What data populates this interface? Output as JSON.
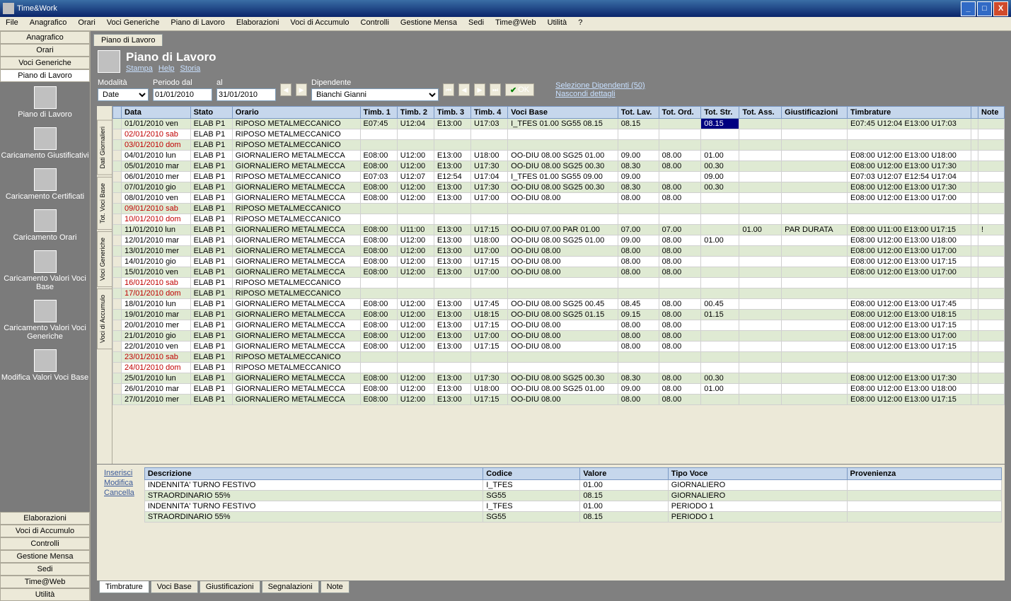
{
  "window": {
    "title": "Time&Work"
  },
  "menubar": [
    "File",
    "Anagrafico",
    "Orari",
    "Voci Generiche",
    "Piano di Lavoro",
    "Elaborazioni",
    "Voci di Accumulo",
    "Controlli",
    "Gestione Mensa",
    "Sedi",
    "Time@Web",
    "Utilità",
    "?"
  ],
  "sidebar_top": [
    "Anagrafico",
    "Orari",
    "Voci Generiche",
    "Piano di Lavoro"
  ],
  "sidebar_icons": [
    "Piano di Lavoro",
    "Caricamento Giustificativi",
    "Caricamento Certificati",
    "Caricamento Orari",
    "Caricamento Valori Voci Base",
    "Caricamento Valori Voci Generiche",
    "Modifica Valori Voci Base"
  ],
  "sidebar_bottom": [
    "Elaborazioni",
    "Voci di Accumulo",
    "Controlli",
    "Gestione Mensa",
    "Sedi",
    "Time@Web",
    "Utilità"
  ],
  "tab": "Piano di Lavoro",
  "page": {
    "title": "Piano di Lavoro",
    "links": [
      "Stampa",
      "Help",
      "Storia"
    ]
  },
  "filters": {
    "modalita_label": "Modalità",
    "modalita_value": "Date",
    "periodo_label": "Periodo dal",
    "dal": "01/01/2010",
    "al_label": "al",
    "al": "31/01/2010",
    "dipendente_label": "Dipendente",
    "dipendente": "Bianchi Gianni",
    "ok": "OK",
    "sel_link": "Selezione Dipendenti (50)",
    "hide_link": "Nascondi dettagli"
  },
  "side_tabs": [
    "Dati Giornalieri",
    "Tot. Voci Base",
    "Voci Generiche",
    "Voci di Accumulo"
  ],
  "grid": {
    "headers": [
      "",
      "Data",
      "Stato",
      "Orario",
      "Timb. 1",
      "Timb. 2",
      "Timb. 3",
      "Timb. 4",
      "Voci Base",
      "Tot. Lav.",
      "Tot. Ord.",
      "Tot. Str.",
      "Tot. Ass.",
      "Giustificazioni",
      "Timbrature",
      "",
      "Note"
    ],
    "rows": [
      {
        "alt": true,
        "d": "01/01/2010 ven",
        "s": "ELAB P1",
        "o": "RIPOSO METALMECCANICO",
        "t": [
          "E07:45",
          "U12:04",
          "E13:00",
          "U17:03"
        ],
        "vb": "I_TFES 01.00 SG55 08.15",
        "tl": "08.15",
        "to": "",
        "ts": "08.15",
        "ts_sel": true,
        "ta": "",
        "g": "",
        "tm": "E07:45 U12:04 E13:00 U17:03",
        "n": ""
      },
      {
        "d": "02/01/2010 sab",
        "red": true,
        "s": "ELAB P1",
        "o": "RIPOSO METALMECCANICO",
        "t": [
          "",
          "",
          "",
          ""
        ],
        "vb": "",
        "tl": "",
        "to": "",
        "ts": "",
        "ta": "",
        "g": "",
        "tm": "",
        "n": ""
      },
      {
        "alt": true,
        "d": "03/01/2010 dom",
        "red": true,
        "s": "ELAB P1",
        "o": "RIPOSO METALMECCANICO",
        "t": [
          "",
          "",
          "",
          ""
        ],
        "vb": "",
        "tl": "",
        "to": "",
        "ts": "",
        "ta": "",
        "g": "",
        "tm": "",
        "n": ""
      },
      {
        "d": "04/01/2010 lun",
        "s": "ELAB P1",
        "o": "GIORNALIERO METALMECCA",
        "t": [
          "E08:00",
          "U12:00",
          "E13:00",
          "U18:00"
        ],
        "vb": "OO-DIU 08.00 SG25 01.00",
        "tl": "09.00",
        "to": "08.00",
        "ts": "01.00",
        "ta": "",
        "g": "",
        "tm": "E08:00 U12:00 E13:00 U18:00",
        "n": ""
      },
      {
        "alt": true,
        "d": "05/01/2010 mar",
        "s": "ELAB P1",
        "o": "GIORNALIERO METALMECCA",
        "t": [
          "E08:00",
          "U12:00",
          "E13:00",
          "U17:30"
        ],
        "vb": "OO-DIU 08.00 SG25 00.30",
        "tl": "08.30",
        "to": "08.00",
        "ts": "00.30",
        "ta": "",
        "g": "",
        "tm": "E08:00 U12:00 E13:00 U17:30",
        "n": ""
      },
      {
        "d": "06/01/2010 mer",
        "s": "ELAB P1",
        "o": "RIPOSO METALMECCANICO",
        "t": [
          "E07:03",
          "U12:07",
          "E12:54",
          "U17:04"
        ],
        "vb": "I_TFES 01.00 SG55 09.00",
        "tl": "09.00",
        "to": "",
        "ts": "09.00",
        "ta": "",
        "g": "",
        "tm": "E07:03 U12:07 E12:54 U17:04",
        "n": ""
      },
      {
        "alt": true,
        "d": "07/01/2010 gio",
        "s": "ELAB P1",
        "o": "GIORNALIERO METALMECCA",
        "t": [
          "E08:00",
          "U12:00",
          "E13:00",
          "U17:30"
        ],
        "vb": "OO-DIU 08.00 SG25 00.30",
        "tl": "08.30",
        "to": "08.00",
        "ts": "00.30",
        "ta": "",
        "g": "",
        "tm": "E08:00 U12:00 E13:00 U17:30",
        "n": ""
      },
      {
        "d": "08/01/2010 ven",
        "s": "ELAB P1",
        "o": "GIORNALIERO METALMECCA",
        "t": [
          "E08:00",
          "U12:00",
          "E13:00",
          "U17:00"
        ],
        "vb": "OO-DIU 08.00",
        "tl": "08.00",
        "to": "08.00",
        "ts": "",
        "ta": "",
        "g": "",
        "tm": "E08:00 U12:00 E13:00 U17:00",
        "n": ""
      },
      {
        "alt": true,
        "d": "09/01/2010 sab",
        "red": true,
        "s": "ELAB P1",
        "o": "RIPOSO METALMECCANICO",
        "t": [
          "",
          "",
          "",
          ""
        ],
        "vb": "",
        "tl": "",
        "to": "",
        "ts": "",
        "ta": "",
        "g": "",
        "tm": "",
        "n": ""
      },
      {
        "d": "10/01/2010 dom",
        "red": true,
        "s": "ELAB P1",
        "o": "RIPOSO METALMECCANICO",
        "t": [
          "",
          "",
          "",
          ""
        ],
        "vb": "",
        "tl": "",
        "to": "",
        "ts": "",
        "ta": "",
        "g": "",
        "tm": "",
        "n": ""
      },
      {
        "alt": true,
        "d": "11/01/2010 lun",
        "s": "ELAB P1",
        "o": "GIORNALIERO METALMECCA",
        "t": [
          "E08:00",
          "U11:00",
          "E13:00",
          "U17:15"
        ],
        "vb": "OO-DIU 07.00 PAR 01.00",
        "tl": "07.00",
        "to": "07.00",
        "ts": "",
        "ta": "01.00",
        "g": "PAR DURATA",
        "tm": "E08:00 U11:00 E13:00 U17:15",
        "n": "!"
      },
      {
        "d": "12/01/2010 mar",
        "s": "ELAB P1",
        "o": "GIORNALIERO METALMECCA",
        "t": [
          "E08:00",
          "U12:00",
          "E13:00",
          "U18:00"
        ],
        "vb": "OO-DIU 08.00 SG25 01.00",
        "tl": "09.00",
        "to": "08.00",
        "ts": "01.00",
        "ta": "",
        "g": "",
        "tm": "E08:00 U12:00 E13:00 U18:00",
        "n": ""
      },
      {
        "alt": true,
        "d": "13/01/2010 mer",
        "s": "ELAB P1",
        "o": "GIORNALIERO METALMECCA",
        "t": [
          "E08:00",
          "U12:00",
          "E13:00",
          "U17:00"
        ],
        "vb": "OO-DIU 08.00",
        "tl": "08.00",
        "to": "08.00",
        "ts": "",
        "ta": "",
        "g": "",
        "tm": "E08:00 U12:00 E13:00 U17:00",
        "n": ""
      },
      {
        "d": "14/01/2010 gio",
        "s": "ELAB P1",
        "o": "GIORNALIERO METALMECCA",
        "t": [
          "E08:00",
          "U12:00",
          "E13:00",
          "U17:15"
        ],
        "vb": "OO-DIU 08.00",
        "tl": "08.00",
        "to": "08.00",
        "ts": "",
        "ta": "",
        "g": "",
        "tm": "E08:00 U12:00 E13:00 U17:15",
        "n": ""
      },
      {
        "alt": true,
        "d": "15/01/2010 ven",
        "s": "ELAB P1",
        "o": "GIORNALIERO METALMECCA",
        "t": [
          "E08:00",
          "U12:00",
          "E13:00",
          "U17:00"
        ],
        "vb": "OO-DIU 08.00",
        "tl": "08.00",
        "to": "08.00",
        "ts": "",
        "ta": "",
        "g": "",
        "tm": "E08:00 U12:00 E13:00 U17:00",
        "n": ""
      },
      {
        "d": "16/01/2010 sab",
        "red": true,
        "s": "ELAB P1",
        "o": "RIPOSO METALMECCANICO",
        "t": [
          "",
          "",
          "",
          ""
        ],
        "vb": "",
        "tl": "",
        "to": "",
        "ts": "",
        "ta": "",
        "g": "",
        "tm": "",
        "n": ""
      },
      {
        "alt": true,
        "d": "17/01/2010 dom",
        "red": true,
        "s": "ELAB P1",
        "o": "RIPOSO METALMECCANICO",
        "t": [
          "",
          "",
          "",
          ""
        ],
        "vb": "",
        "tl": "",
        "to": "",
        "ts": "",
        "ta": "",
        "g": "",
        "tm": "",
        "n": ""
      },
      {
        "d": "18/01/2010 lun",
        "s": "ELAB P1",
        "o": "GIORNALIERO METALMECCA",
        "t": [
          "E08:00",
          "U12:00",
          "E13:00",
          "U17:45"
        ],
        "vb": "OO-DIU 08.00 SG25 00.45",
        "tl": "08.45",
        "to": "08.00",
        "ts": "00.45",
        "ta": "",
        "g": "",
        "tm": "E08:00 U12:00 E13:00 U17:45",
        "n": ""
      },
      {
        "alt": true,
        "d": "19/01/2010 mar",
        "s": "ELAB P1",
        "o": "GIORNALIERO METALMECCA",
        "t": [
          "E08:00",
          "U12:00",
          "E13:00",
          "U18:15"
        ],
        "vb": "OO-DIU 08.00 SG25 01.15",
        "tl": "09.15",
        "to": "08.00",
        "ts": "01.15",
        "ta": "",
        "g": "",
        "tm": "E08:00 U12:00 E13:00 U18:15",
        "n": ""
      },
      {
        "d": "20/01/2010 mer",
        "s": "ELAB P1",
        "o": "GIORNALIERO METALMECCA",
        "t": [
          "E08:00",
          "U12:00",
          "E13:00",
          "U17:15"
        ],
        "vb": "OO-DIU 08.00",
        "tl": "08.00",
        "to": "08.00",
        "ts": "",
        "ta": "",
        "g": "",
        "tm": "E08:00 U12:00 E13:00 U17:15",
        "n": ""
      },
      {
        "alt": true,
        "d": "21/01/2010 gio",
        "s": "ELAB P1",
        "o": "GIORNALIERO METALMECCA",
        "t": [
          "E08:00",
          "U12:00",
          "E13:00",
          "U17:00"
        ],
        "vb": "OO-DIU 08.00",
        "tl": "08.00",
        "to": "08.00",
        "ts": "",
        "ta": "",
        "g": "",
        "tm": "E08:00 U12:00 E13:00 U17:00",
        "n": ""
      },
      {
        "d": "22/01/2010 ven",
        "s": "ELAB P1",
        "o": "GIORNALIERO METALMECCA",
        "t": [
          "E08:00",
          "U12:00",
          "E13:00",
          "U17:15"
        ],
        "vb": "OO-DIU 08.00",
        "tl": "08.00",
        "to": "08.00",
        "ts": "",
        "ta": "",
        "g": "",
        "tm": "E08:00 U12:00 E13:00 U17:15",
        "n": ""
      },
      {
        "alt": true,
        "d": "23/01/2010 sab",
        "red": true,
        "s": "ELAB P1",
        "o": "RIPOSO METALMECCANICO",
        "t": [
          "",
          "",
          "",
          ""
        ],
        "vb": "",
        "tl": "",
        "to": "",
        "ts": "",
        "ta": "",
        "g": "",
        "tm": "",
        "n": ""
      },
      {
        "d": "24/01/2010 dom",
        "red": true,
        "s": "ELAB P1",
        "o": "RIPOSO METALMECCANICO",
        "t": [
          "",
          "",
          "",
          ""
        ],
        "vb": "",
        "tl": "",
        "to": "",
        "ts": "",
        "ta": "",
        "g": "",
        "tm": "",
        "n": ""
      },
      {
        "alt": true,
        "d": "25/01/2010 lun",
        "s": "ELAB P1",
        "o": "GIORNALIERO METALMECCA",
        "t": [
          "E08:00",
          "U12:00",
          "E13:00",
          "U17:30"
        ],
        "vb": "OO-DIU 08.00 SG25 00.30",
        "tl": "08.30",
        "to": "08.00",
        "ts": "00.30",
        "ta": "",
        "g": "",
        "tm": "E08:00 U12:00 E13:00 U17:30",
        "n": ""
      },
      {
        "d": "26/01/2010 mar",
        "s": "ELAB P1",
        "o": "GIORNALIERO METALMECCA",
        "t": [
          "E08:00",
          "U12:00",
          "E13:00",
          "U18:00"
        ],
        "vb": "OO-DIU 08.00 SG25 01.00",
        "tl": "09.00",
        "to": "08.00",
        "ts": "01.00",
        "ta": "",
        "g": "",
        "tm": "E08:00 U12:00 E13:00 U18:00",
        "n": ""
      },
      {
        "alt": true,
        "d": "27/01/2010 mer",
        "s": "ELAB P1",
        "o": "GIORNALIERO METALMECCA",
        "t": [
          "E08:00",
          "U12:00",
          "E13:00",
          "U17:15"
        ],
        "vb": "OO-DIU 08.00",
        "tl": "08.00",
        "to": "08.00",
        "ts": "",
        "ta": "",
        "g": "",
        "tm": "E08:00 U12:00 E13:00 U17:15",
        "n": ""
      }
    ]
  },
  "bottom": {
    "actions": [
      "Inserisci",
      "Modifica",
      "Cancella"
    ],
    "headers": [
      "Descrizione",
      "Codice",
      "Valore",
      "Tipo Voce",
      "Provenienza"
    ],
    "rows": [
      [
        "INDENNITA' TURNO FESTIVO",
        "I_TFES",
        "01.00",
        "GIORNALIERO",
        ""
      ],
      [
        "STRAORDINARIO 55%",
        "SG55",
        "08.15",
        "GIORNALIERO",
        ""
      ],
      [
        "INDENNITA' TURNO FESTIVO",
        "I_TFES",
        "01.00",
        "PERIODO 1",
        ""
      ],
      [
        "STRAORDINARIO 55%",
        "SG55",
        "08.15",
        "PERIODO 1",
        ""
      ]
    ],
    "tabs": [
      "Timbrature",
      "Voci Base",
      "Giustificazioni",
      "Segnalazioni",
      "Note"
    ]
  }
}
